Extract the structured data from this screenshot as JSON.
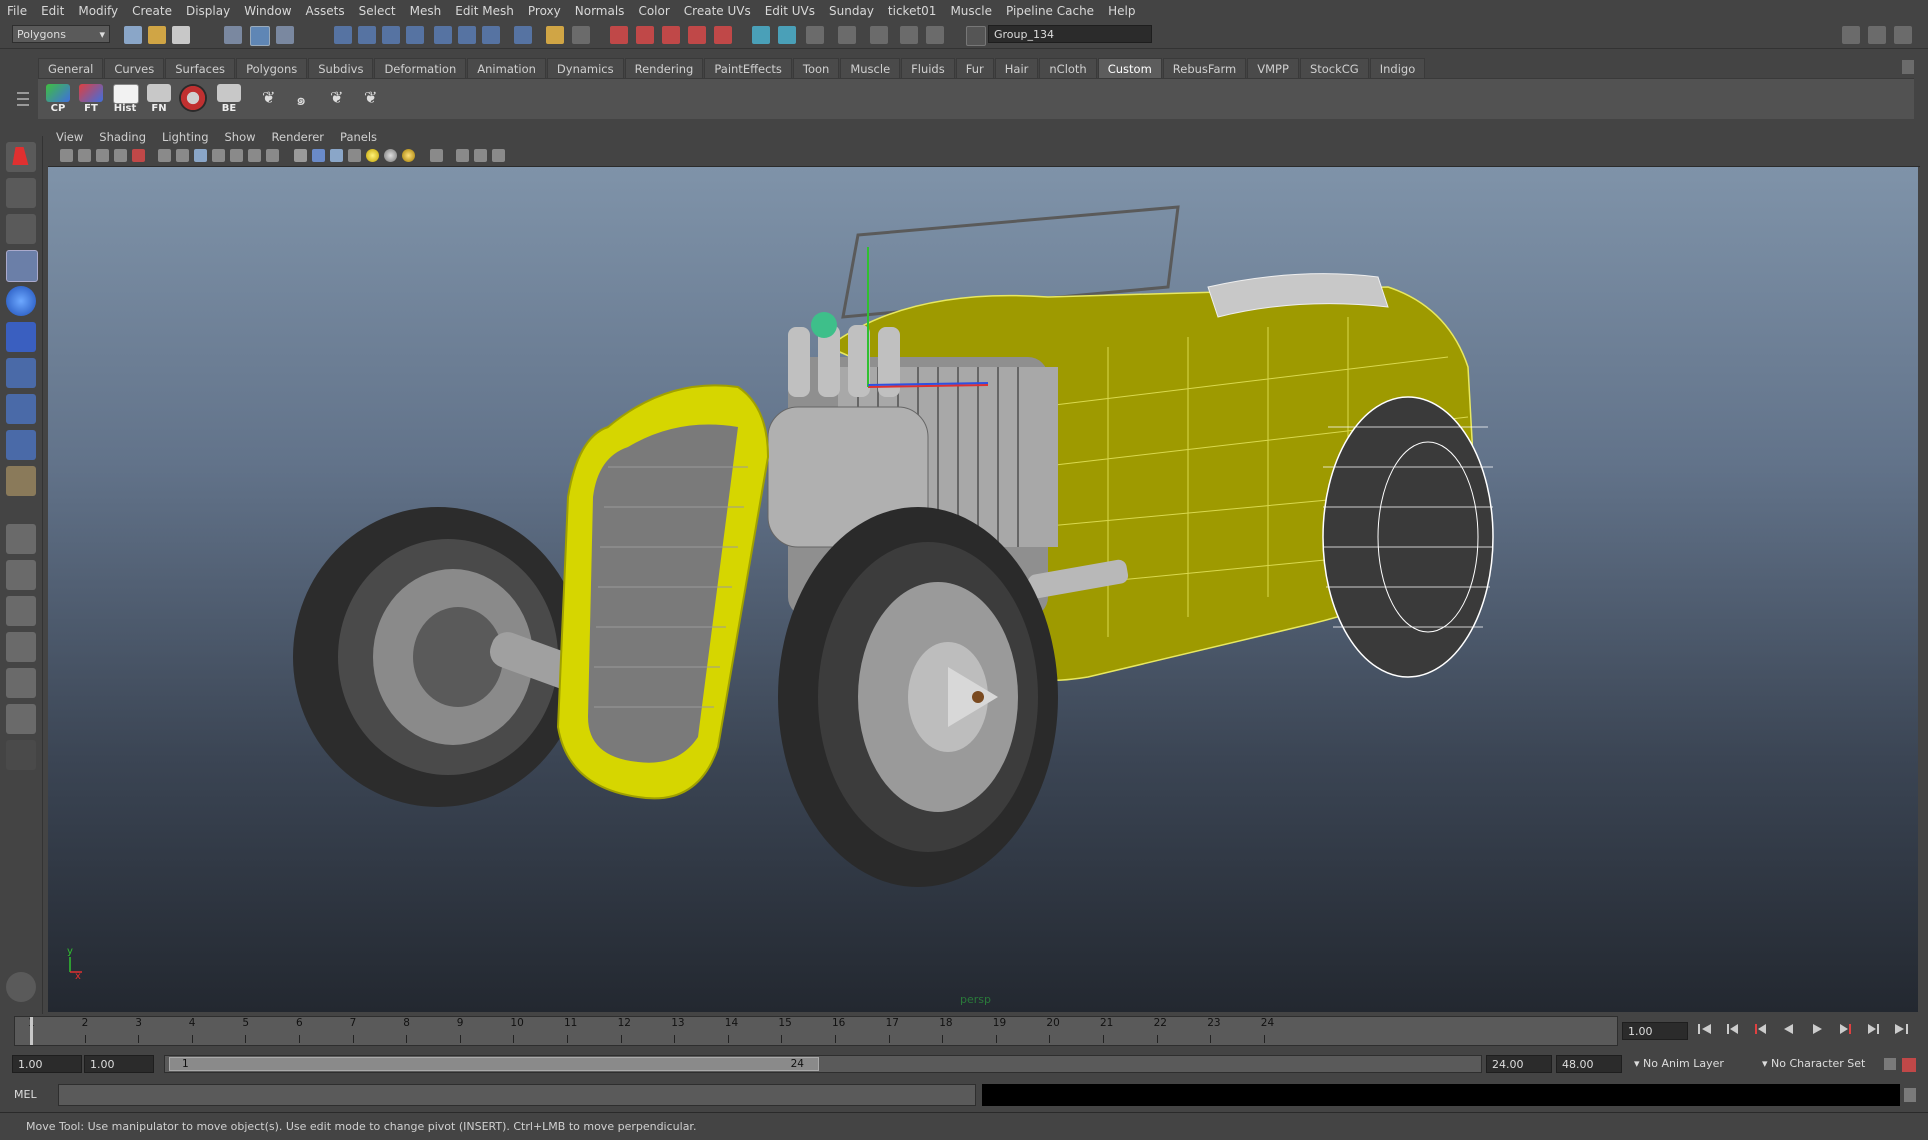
{
  "menubar": {
    "items": [
      "File",
      "Edit",
      "Modify",
      "Create",
      "Display",
      "Window",
      "Assets",
      "Select",
      "Mesh",
      "Edit Mesh",
      "Proxy",
      "Normals",
      "Color",
      "Create UVs",
      "Edit UVs",
      "Sunday",
      "ticket01",
      "Muscle",
      "Pipeline Cache",
      "Help"
    ]
  },
  "statusline": {
    "mode": "Polygons",
    "selection_field": "Group_134"
  },
  "shelf": {
    "tabs": [
      "General",
      "Curves",
      "Surfaces",
      "Polygons",
      "Subdivs",
      "Deformation",
      "Animation",
      "Dynamics",
      "Rendering",
      "PaintEffects",
      "Toon",
      "Muscle",
      "Fluids",
      "Fur",
      "Hair",
      "nCloth",
      "Custom",
      "RebusFarm",
      "VMPP",
      "StockCG",
      "Indigo"
    ],
    "active_tab": "Custom",
    "buttons": [
      "CP",
      "FT",
      "Hist",
      "FN",
      "",
      "BE"
    ]
  },
  "panel": {
    "menus": [
      "View",
      "Shading",
      "Lighting",
      "Show",
      "Renderer",
      "Panels"
    ],
    "camera_label": "persp"
  },
  "axis": {
    "y": "y",
    "x": "x"
  },
  "timeline": {
    "ticks": [
      "1",
      "2",
      "3",
      "4",
      "5",
      "6",
      "7",
      "8",
      "9",
      "10",
      "11",
      "12",
      "13",
      "14",
      "15",
      "16",
      "17",
      "18",
      "19",
      "20",
      "21",
      "22",
      "23",
      "24"
    ],
    "current_frame": "1.00"
  },
  "range": {
    "start": "1.00",
    "playback_start": "1.00",
    "slider_min": "1",
    "slider_max": "24",
    "playback_end": "24.00",
    "end": "48.00",
    "anim_layer": "No Anim Layer",
    "character_set": "No Character Set"
  },
  "cmdline": {
    "label": "MEL"
  },
  "helpline": {
    "text": "Move Tool: Use manipulator to move object(s). Use edit mode to change pivot (INSERT).  Ctrl+LMB to move perpendicular."
  },
  "colors": {
    "accent_yellow": "#d6d600",
    "viewport_top": "#7f93a9",
    "viewport_bottom": "#232830"
  }
}
